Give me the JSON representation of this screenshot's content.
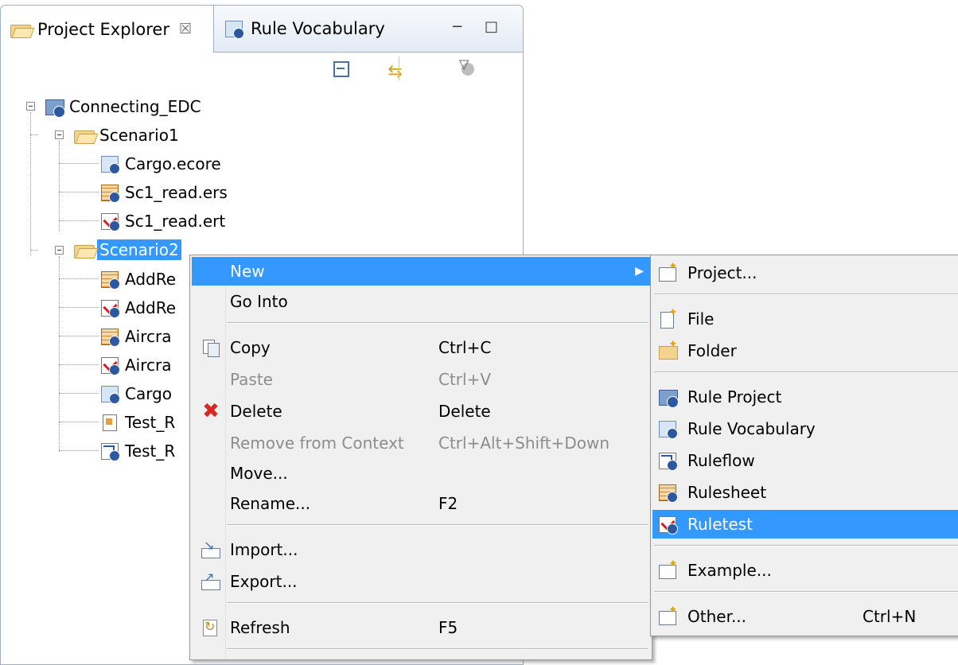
{
  "tabs": {
    "project_explorer": {
      "label": "Project Explorer",
      "icon": "project-explorer-icon",
      "close": "☒"
    },
    "rule_vocabulary": {
      "label": "Rule Vocabulary",
      "icon": "rule-vocabulary-icon"
    }
  },
  "view_controls": {
    "minimize": "−",
    "maximize": "□"
  },
  "toolbar": {
    "collapse_all_icon": "collapse-all-icon",
    "link_editor_icon": "link-with-editor-icon",
    "filter_icon": "filter-icon",
    "menu_icon": "▽"
  },
  "tree": {
    "root": "Connecting_EDC",
    "scenario1": {
      "label": "Scenario1",
      "children": [
        "Cargo.ecore",
        "Sc1_read.ers",
        "Sc1_read.ert"
      ]
    },
    "scenario2": {
      "label": "Scenario2",
      "children": [
        "AddRe",
        "AddRe",
        "Aircra",
        "Aircra",
        "Cargo",
        "Test_R",
        "Test_R"
      ]
    }
  },
  "context_menu": {
    "new": "New",
    "go_into": "Go Into",
    "copy": "Copy",
    "copy_shortcut": "Ctrl+C",
    "paste": "Paste",
    "paste_shortcut": "Ctrl+V",
    "delete": "Delete",
    "delete_shortcut": "Delete",
    "remove_from_context": "Remove from Context",
    "remove_shortcut": "Ctrl+Alt+Shift+Down",
    "move": "Move...",
    "rename": "Rename...",
    "rename_shortcut": "F2",
    "import": "Import...",
    "export": "Export...",
    "refresh": "Refresh",
    "refresh_shortcut": "F5",
    "submenu_arrow": "▶"
  },
  "new_submenu": {
    "project": "Project...",
    "file": "File",
    "folder": "Folder",
    "rule_project": "Rule Project",
    "rule_vocabulary": "Rule Vocabulary",
    "ruleflow": "Ruleflow",
    "rulesheet": "Rulesheet",
    "ruletest": "Ruletest",
    "example": "Example...",
    "other": "Other...",
    "other_shortcut": "Ctrl+N"
  },
  "colors": {
    "selection": "#3399ff",
    "menu_background": "#f0f0f0",
    "tab_border": "#a0afc3"
  }
}
